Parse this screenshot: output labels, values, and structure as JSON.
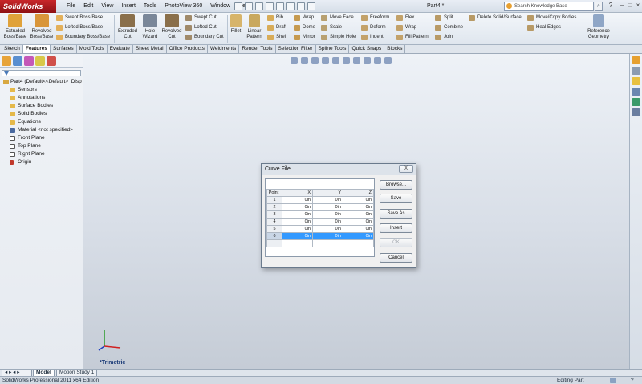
{
  "app": {
    "brand": "SolidWorks",
    "document_title": "Part4 *",
    "menu": [
      "File",
      "Edit",
      "View",
      "Insert",
      "Tools",
      "PhotoView 360",
      "Window",
      "Help"
    ],
    "search_placeholder": "Search Knowledge Base"
  },
  "ribbon": {
    "big": [
      {
        "label": "Extruded Boss/Base"
      },
      {
        "label": "Revolved Boss/Base"
      },
      {
        "label": "Extruded Cut"
      },
      {
        "label": "Hole Wizard"
      },
      {
        "label": "Revolved Cut"
      },
      {
        "label": "Fillet"
      },
      {
        "label": "Linear Pattern"
      },
      {
        "label": "Reference Geometry"
      }
    ],
    "small": {
      "swept_boss": "Swept Boss/Base",
      "lofted_boss": "Lofted Boss/Base",
      "boundary_boss": "Boundary Boss/Base",
      "swept_cut": "Swept Cut",
      "lofted_cut": "Lofted Cut",
      "boundary_cut": "Boundary Cut",
      "rib": "Rib",
      "draft": "Draft",
      "shell": "Shell",
      "wrap": "Wrap",
      "dome": "Dome",
      "mirror": "Mirror",
      "move_face": "Move Face",
      "scale": "Scale",
      "simple_hole": "Simple Hole",
      "freeform": "Freeform",
      "deform": "Deform",
      "indent": "Indent",
      "flex": "Flex",
      "wrap2": "Wrap",
      "fill_pattern": "Fill Pattern",
      "split": "Split",
      "combine": "Combine",
      "join": "Join",
      "delete_solid": "Delete Solid/Surface",
      "move_copy": "Move/Copy Bodies",
      "heal_edges": "Heal Edges"
    }
  },
  "tabs": [
    "Sketch",
    "Features",
    "Surfaces",
    "Mold Tools",
    "Evaluate",
    "Sheet Metal",
    "Office Products",
    "Weldments",
    "Render Tools",
    "Selection Filter",
    "Spline Tools",
    "Quick Snaps",
    "Blocks"
  ],
  "active_tab": "Features",
  "tree": {
    "root": "Part4  (Default<<Default>_Disp",
    "items": [
      "Sensors",
      "Annotations",
      "Surface Bodies",
      "Solid Bodies",
      "Equations",
      "Material <not specified>",
      "Front Plane",
      "Top Plane",
      "Right Plane",
      "Origin"
    ]
  },
  "viewport": {
    "view_label": "*Trimetric"
  },
  "bottom_tabs": [
    "Model",
    "Motion Study 1"
  ],
  "status": {
    "left": "SolidWorks Professional 2011 x64 Edition",
    "right": "Editing Part"
  },
  "dialog": {
    "title": "Curve File",
    "close_label": "X",
    "columns": [
      "Point",
      "X",
      "Y",
      "Z"
    ],
    "rows": [
      {
        "point": "1",
        "x": "0in",
        "y": "0in",
        "z": "0in"
      },
      {
        "point": "2",
        "x": "0in",
        "y": "0in",
        "z": "0in"
      },
      {
        "point": "3",
        "x": "0in",
        "y": "0in",
        "z": "0in"
      },
      {
        "point": "4",
        "x": "0in",
        "y": "0in",
        "z": "0in"
      },
      {
        "point": "5",
        "x": "0in",
        "y": "0in",
        "z": "0in"
      },
      {
        "point": "6",
        "x": "0in",
        "y": "0in",
        "z": "0in"
      }
    ],
    "selected_row": 6,
    "buttons": {
      "browse": "Browse...",
      "save": "Save",
      "save_as": "Save As",
      "insert": "Insert",
      "ok": "OK",
      "cancel": "Cancel"
    }
  },
  "colors": {
    "brand_red": "#c8262a",
    "selection_blue": "#3399ff",
    "viewport_top": "#eef2f7"
  }
}
